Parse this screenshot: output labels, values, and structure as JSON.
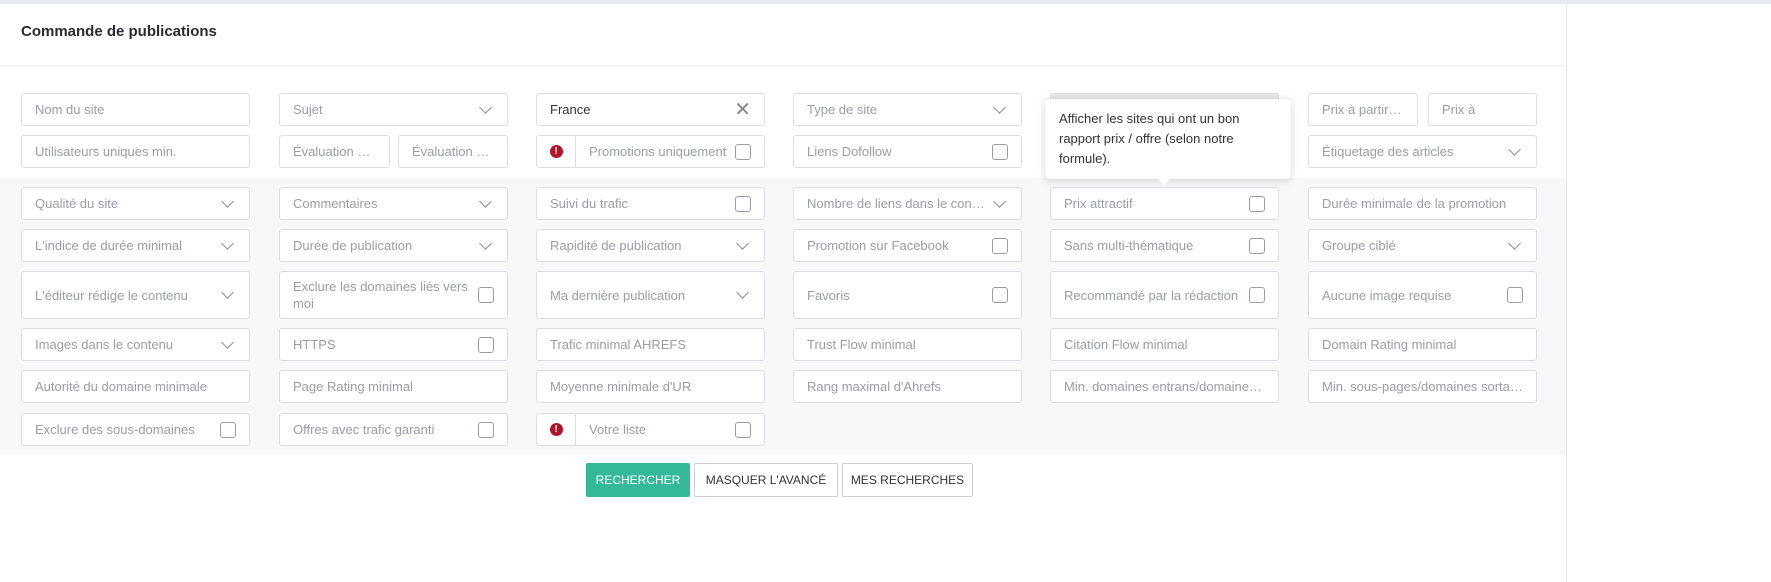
{
  "header": {
    "title": "Commande de publications"
  },
  "colors": {
    "accent": "#34b89a",
    "promo_icon": "#b3132a"
  },
  "rows": [
    [
      {
        "label": "Nom du site",
        "type": "text"
      },
      {
        "label": "Sujet",
        "type": "select"
      },
      {
        "label": "France",
        "type": "clear"
      },
      {
        "label": "Type de site",
        "type": "select"
      },
      {
        "label": "",
        "type": "disabled"
      },
      {
        "type": "split",
        "parts": [
          {
            "label": "Prix à partir de"
          },
          {
            "label": "Prix à"
          }
        ]
      }
    ],
    [
      {
        "label": "Utilisateurs uniques min.",
        "type": "text"
      },
      {
        "type": "split",
        "parts": [
          {
            "label": "Évaluation mini"
          },
          {
            "label": "Évaluation visuelle"
          }
        ]
      },
      {
        "label": "Promotions uniquement",
        "type": "promo"
      },
      {
        "label": "Liens Dofollow",
        "type": "check"
      },
      null,
      {
        "label": "Étiquetage des articles",
        "type": "select"
      }
    ],
    [
      {
        "label": "Qualité du site",
        "type": "select"
      },
      {
        "label": "Commentaires",
        "type": "select"
      },
      {
        "label": "Suivi du trafic",
        "type": "check"
      },
      {
        "label": "Nombre de liens dans le contenu",
        "type": "select"
      },
      {
        "label": "Prix attractif",
        "type": "check"
      },
      {
        "label": "Durée minimale de la promotion",
        "type": "text"
      }
    ],
    [
      {
        "label": "L'indice de durée minimal",
        "type": "select"
      },
      {
        "label": "Durée de publication",
        "type": "select"
      },
      {
        "label": "Rapidité de publication",
        "type": "select"
      },
      {
        "label": "Promotion sur Facebook",
        "type": "check"
      },
      {
        "label": "Sans multi-thématique",
        "type": "check"
      },
      {
        "label": "Groupe ciblé",
        "type": "select"
      }
    ],
    [
      {
        "label": "L'éditeur rédige le contenu",
        "type": "select"
      },
      {
        "label": "Exclure les domaines liés vers moi",
        "type": "check"
      },
      {
        "label": "Ma dernière publication",
        "type": "select"
      },
      {
        "label": "Favoris",
        "type": "check"
      },
      {
        "label": "Recommandé par la rédaction",
        "type": "check"
      },
      {
        "label": "Aucune image requise",
        "type": "check"
      }
    ],
    [
      {
        "label": "Images dans le contenu",
        "type": "select"
      },
      {
        "label": "HTTPS",
        "type": "check"
      },
      {
        "label": "Trafic minimal AHREFS",
        "type": "text"
      },
      {
        "label": "Trust Flow minimal",
        "type": "text"
      },
      {
        "label": "Citation Flow minimal",
        "type": "text"
      },
      {
        "label": "Domain Rating minimal",
        "type": "text"
      }
    ],
    [
      {
        "label": "Autorité du domaine minimale",
        "type": "text"
      },
      {
        "label": "Page Rating minimal",
        "type": "text"
      },
      {
        "label": "Moyenne minimale d'UR",
        "type": "text"
      },
      {
        "label": "Rang maximal d'Ahrefs",
        "type": "text"
      },
      {
        "label": "Min. domaines entrans/domaines sortants",
        "type": "text"
      },
      {
        "label": "Min. sous-pages/domaines sortants",
        "type": "text"
      }
    ],
    [
      {
        "label": "Exclure des sous-domaines",
        "type": "check"
      },
      {
        "label": "Offres avec trafic garanti",
        "type": "check"
      },
      {
        "label": "Votre liste",
        "type": "promo"
      }
    ]
  ],
  "tooltip": {
    "text": "Afficher les sites qui ont un bon rapport prix / offre (selon notre formule)."
  },
  "buttons": {
    "search": "RECHERCHER",
    "hide_advanced": "MASQUER L'AVANCÉ",
    "my_searches": "MES RECHERCHES"
  }
}
